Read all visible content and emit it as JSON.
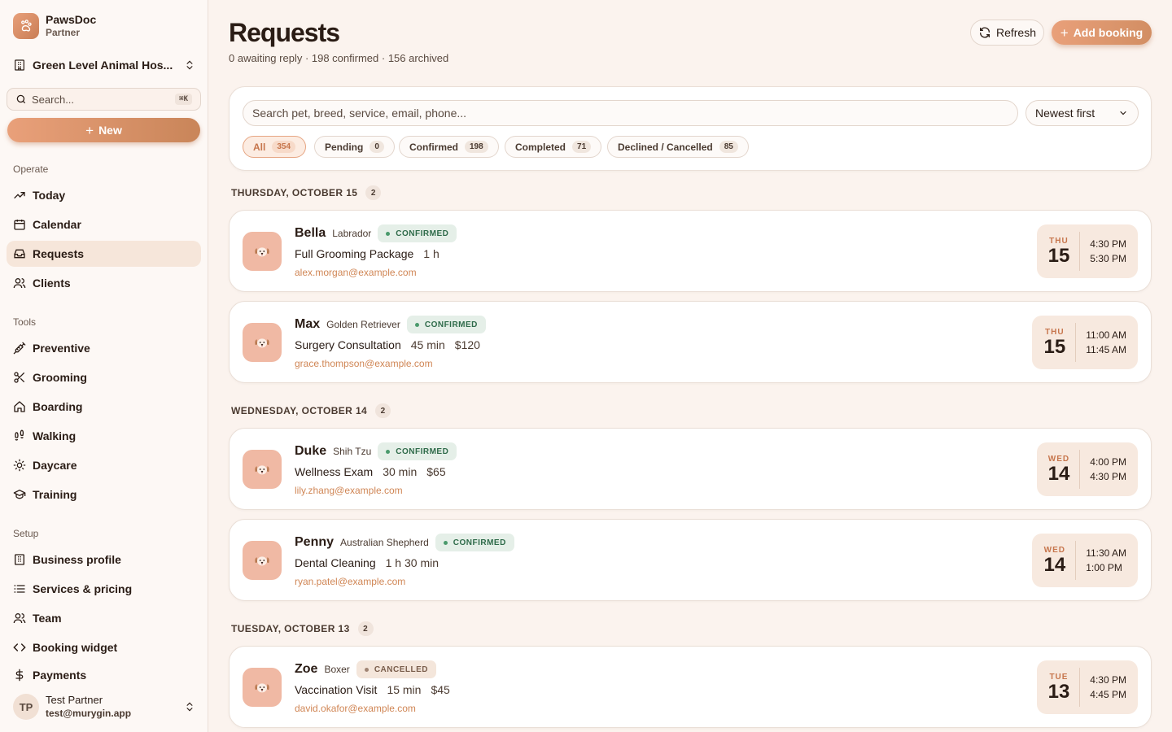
{
  "brand": {
    "name": "PawsDoc",
    "sub": "Partner"
  },
  "org": {
    "name": "Green Level Animal Hos..."
  },
  "search": {
    "placeholder": "Search...",
    "shortcut": "⌘K"
  },
  "new_label": "New",
  "sections": {
    "operate": "Operate",
    "tools": "Tools",
    "setup": "Setup"
  },
  "nav": {
    "today": "Today",
    "calendar": "Calendar",
    "requests": "Requests",
    "clients": "Clients",
    "preventive": "Preventive",
    "grooming": "Grooming",
    "boarding": "Boarding",
    "walking": "Walking",
    "daycare": "Daycare",
    "training": "Training",
    "business_profile": "Business profile",
    "services_pricing": "Services & pricing",
    "team": "Team",
    "booking_widget": "Booking widget",
    "payments": "Payments"
  },
  "user": {
    "initials": "TP",
    "name": "Test Partner",
    "email": "test@murygin.app"
  },
  "header": {
    "title": "Requests",
    "subtitle": "0 awaiting reply · 198 confirmed · 156 archived",
    "refresh": "Refresh",
    "add_booking": "Add booking"
  },
  "filters": {
    "search_placeholder": "Search pet, breed, service, email, phone...",
    "sort": "Newest first",
    "chips": [
      {
        "label": "All",
        "count": "354"
      },
      {
        "label": "Pending",
        "count": "0"
      },
      {
        "label": "Confirmed",
        "count": "198"
      },
      {
        "label": "Completed",
        "count": "71"
      },
      {
        "label": "Declined / Cancelled",
        "count": "85"
      }
    ]
  },
  "days": [
    {
      "label": "THURSDAY, OCTOBER 15",
      "count": "2"
    },
    {
      "label": "WEDNESDAY, OCTOBER 14",
      "count": "2"
    },
    {
      "label": "TUESDAY, OCTOBER 13",
      "count": "2"
    }
  ],
  "bookings": [
    {
      "pet": "Bella",
      "breed": "Labrador",
      "status": "CONFIRMED",
      "service": "Full Grooming Package",
      "duration": "1 h",
      "price": "",
      "email": "alex.morgan@example.com",
      "dow": "THU",
      "day": "15",
      "start": "4:30 PM",
      "end": "5:30 PM"
    },
    {
      "pet": "Max",
      "breed": "Golden Retriever",
      "status": "CONFIRMED",
      "service": "Surgery Consultation",
      "duration": "45 min",
      "price": "$120",
      "email": "grace.thompson@example.com",
      "dow": "THU",
      "day": "15",
      "start": "11:00 AM",
      "end": "11:45 AM"
    },
    {
      "pet": "Duke",
      "breed": "Shih Tzu",
      "status": "CONFIRMED",
      "service": "Wellness Exam",
      "duration": "30 min",
      "price": "$65",
      "email": "lily.zhang@example.com",
      "dow": "WED",
      "day": "14",
      "start": "4:00 PM",
      "end": "4:30 PM"
    },
    {
      "pet": "Penny",
      "breed": "Australian Shepherd",
      "status": "CONFIRMED",
      "service": "Dental Cleaning",
      "duration": "1 h 30 min",
      "price": "",
      "email": "ryan.patel@example.com",
      "dow": "WED",
      "day": "14",
      "start": "11:30 AM",
      "end": "1:00 PM"
    },
    {
      "pet": "Zoe",
      "breed": "Boxer",
      "status": "CANCELLED",
      "service": "Vaccination Visit",
      "duration": "15 min",
      "price": "$45",
      "email": "david.okafor@example.com",
      "dow": "TUE",
      "day": "13",
      "start": "4:30 PM",
      "end": "4:45 PM"
    }
  ],
  "colors": {
    "accent": "#e9a07a",
    "confirmed": "#2f6b4a",
    "cancelled": "#7a5e4c"
  },
  "pet_icon": "dog-face-icon"
}
